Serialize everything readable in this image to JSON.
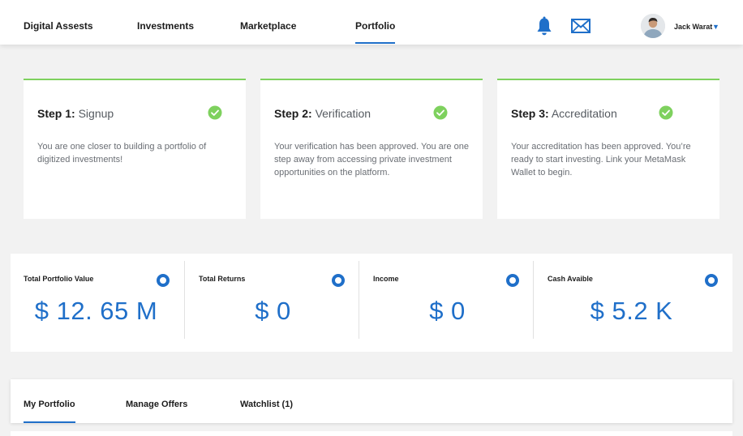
{
  "nav": {
    "items": [
      "Digital Assests",
      "Investments",
      "Marketplace",
      "Portfolio"
    ],
    "active_index": 3,
    "user_name": "Jack Warat",
    "caret": "▼",
    "icons": [
      "bell-icon",
      "mail-icon"
    ],
    "accent": "#1f6fc9"
  },
  "steps": [
    {
      "label": "Step 1:",
      "title": "Signup",
      "description": "You are one closer to building a portfolio of digitized investments!",
      "status": "complete"
    },
    {
      "label": "Step 2:",
      "title": "Verification",
      "description": "Your verification has been approved. You are one step away from accessing private investment opportunities on the platform.",
      "status": "complete"
    },
    {
      "label": "Step 3:",
      "title": "Accreditation",
      "description": "Your accreditation has been approved. You’re ready to start investing. Link your MetaMask Wallet to begin.",
      "status": "complete"
    }
  ],
  "stats": [
    {
      "label": "Total Portfolio Value",
      "value": "$ 12. 65 M"
    },
    {
      "label": "Total Returns",
      "value": "$ 0"
    },
    {
      "label": "Income",
      "value": "$ 0"
    },
    {
      "label": "Cash Avaible",
      "value": "$ 5.2 K"
    }
  ],
  "tabs": {
    "items": [
      "My Portfolio",
      "Manage Offers",
      "Watchlist (1)"
    ],
    "active_index": 0
  },
  "colors": {
    "check": "#7ed15e",
    "accent": "#1f6fc9",
    "background": "#f2f2f2"
  }
}
